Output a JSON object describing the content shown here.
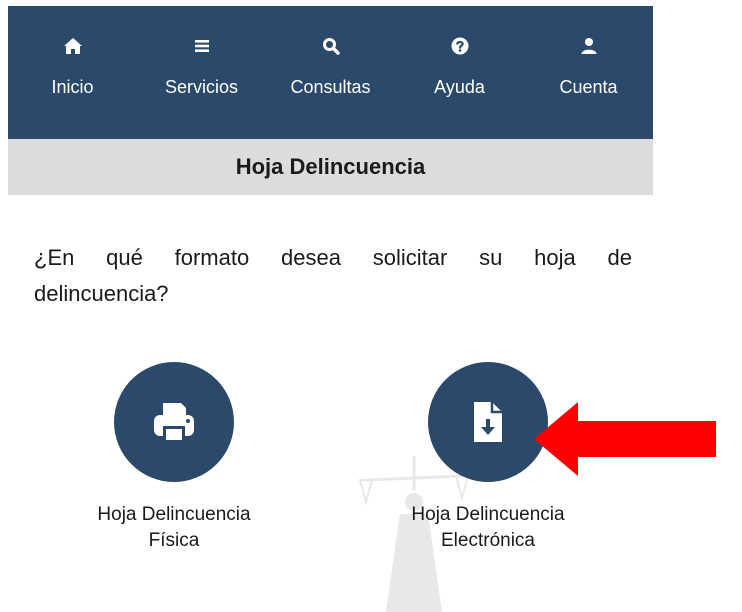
{
  "colors": {
    "navbar_bg": "#2b4a6b",
    "navbar_fg": "#ffffff",
    "subheader_bg": "#dcdcdc",
    "text": "#1a1a1a",
    "circle_bg": "#2b4a6b",
    "arrow": "#ff0000"
  },
  "navbar": {
    "items": [
      {
        "label": "Inicio",
        "icon": "home-icon"
      },
      {
        "label": "Servicios",
        "icon": "menu-bars-icon"
      },
      {
        "label": "Consultas",
        "icon": "search-icon"
      },
      {
        "label": "Ayuda",
        "icon": "help-icon"
      },
      {
        "label": "Cuenta",
        "icon": "user-icon"
      }
    ]
  },
  "subheader": {
    "title": "Hoja Delincuencia"
  },
  "main": {
    "question": "¿En qué formato desea solicitar su hoja de delincuencia?",
    "options": [
      {
        "label_line1": "Hoja Delincuencia",
        "label_line2": "Física",
        "icon": "printer-icon"
      },
      {
        "label_line1": "Hoja Delincuencia",
        "label_line2": "Electrónica",
        "icon": "file-download-icon"
      }
    ]
  },
  "annotation": {
    "icon": "red-arrow-pointing-left"
  }
}
